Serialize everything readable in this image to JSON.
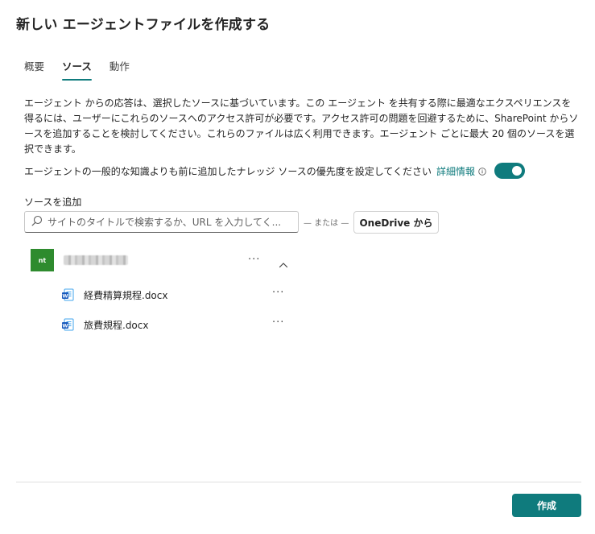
{
  "dialog": {
    "title": "新しい エージェントファイルを作成する"
  },
  "tabs": [
    {
      "label": "概要",
      "active": false
    },
    {
      "label": "ソース",
      "active": true
    },
    {
      "label": "動作",
      "active": false
    }
  ],
  "sources": {
    "description": "エージェント からの応答は、選択したソースに基づいています。この エージェント を共有する際に最適なエクスペリエンスを得るには、ユーザーにこれらのソースへのアクセス許可が必要です。アクセス許可の問題を回避するために、SharePoint からソースを追加することを検討してください。これらのファイルは広く利用できます。エージェント ごとに最大 20 個のソースを選択できます。",
    "priority_text": "エージェントの一般的な知識よりも前に追加したナレッジ ソースの優先度を設定してください",
    "detail_link": "詳細情報",
    "priority_toggle_on": true,
    "add_label": "ソースを追加",
    "search_placeholder": "サイトのタイトルで検索するか、URL を入力してく...",
    "or_text": "— または —",
    "onedrive_button": "OneDrive から",
    "site": {
      "avatar_text": "nt",
      "avatar_color": "#2e8b2e",
      "more_label": "···"
    },
    "files": [
      {
        "name": "経費精算規程.docx",
        "icon": "word-doc-icon",
        "more_label": "···"
      },
      {
        "name": "旅費規程.docx",
        "icon": "word-doc-icon",
        "more_label": "···"
      }
    ]
  },
  "footer": {
    "create_button": "作成"
  },
  "colors": {
    "accent": "#0f7b7d",
    "word_blue": "#185abd"
  }
}
